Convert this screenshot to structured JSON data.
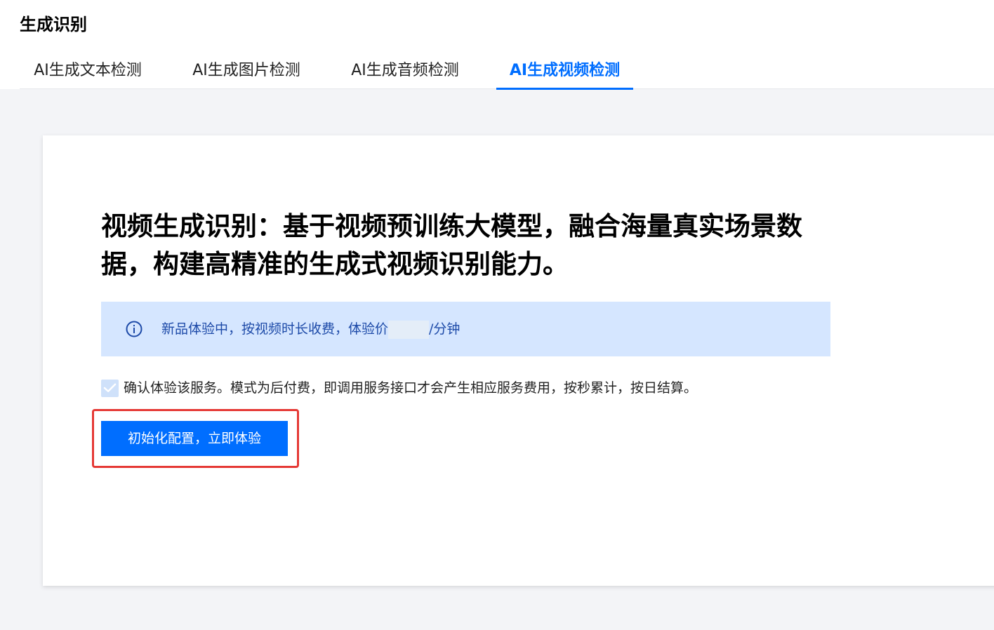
{
  "page": {
    "title": "生成识别"
  },
  "tabs": [
    {
      "label": "AI生成文本检测",
      "active": false
    },
    {
      "label": "AI生成图片检测",
      "active": false
    },
    {
      "label": "AI生成音频检测",
      "active": false
    },
    {
      "label": "AI生成视频检测",
      "active": true
    }
  ],
  "card": {
    "headline": "视频生成识别：基于视频预训练大模型，融合海量真实场景数据，构建高精准的生成式视频识别能力。",
    "notice": {
      "icon": "info-icon",
      "text_prefix": "新品体验中，按视频时长收费，体验价",
      "text_suffix": "/分钟"
    },
    "confirm": {
      "checked": true,
      "text": "确认体验该服务。模式为后付费，即调用服务接口才会产生相应服务费用，按秒累计，按日结算。"
    },
    "primary_button": {
      "label": "初始化配置，立即体验"
    }
  },
  "colors": {
    "accent": "#006eff",
    "notice_bg": "#d5e6ff",
    "highlight": "#e53935"
  }
}
